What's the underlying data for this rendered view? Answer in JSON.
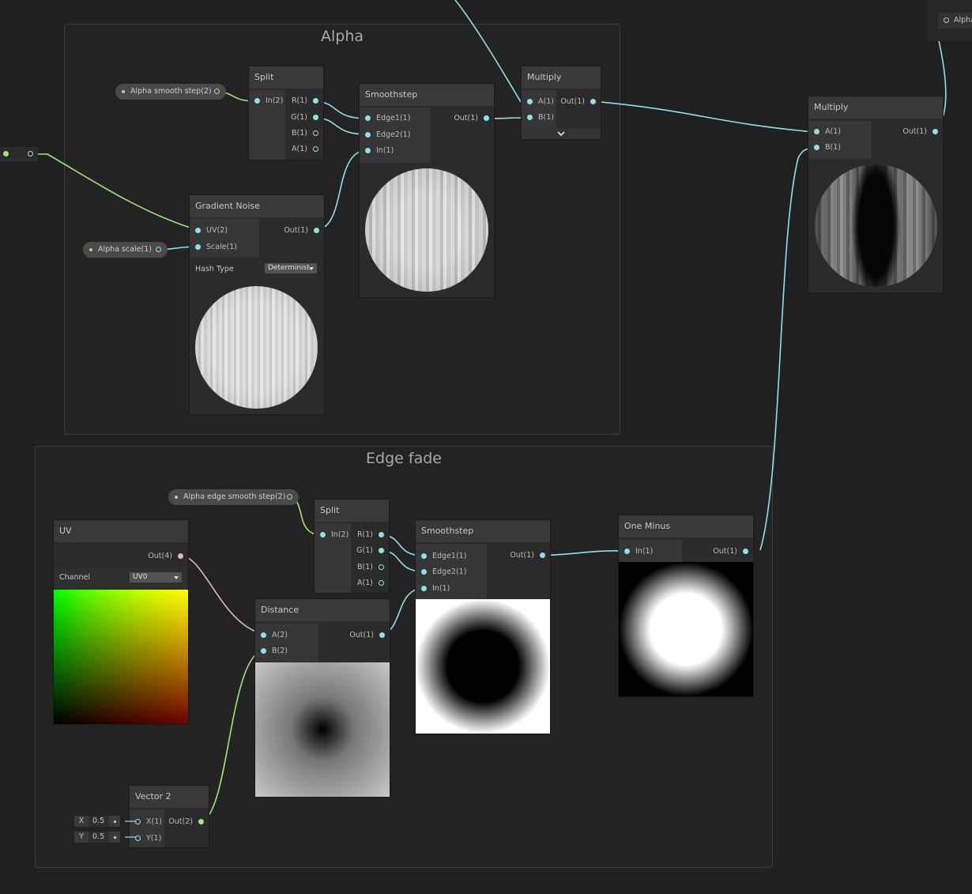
{
  "groups": {
    "alpha": {
      "title": "Alpha"
    },
    "edge_fade": {
      "title": "Edge fade"
    }
  },
  "properties": {
    "alpha_smooth_step": "Alpha smooth step(2)",
    "alpha_scale": "Alpha scale(1)",
    "alpha_edge_smooth_step": "Alpha edge smooth step(2)"
  },
  "nodes": {
    "split_alpha": {
      "title": "Split",
      "in": "In(2)",
      "outs": [
        "R(1)",
        "G(1)",
        "B(1)",
        "A(1)"
      ]
    },
    "smoothstep_alpha": {
      "title": "Smoothstep",
      "ins": [
        "Edge1(1)",
        "Edge2(1)",
        "In(1)"
      ],
      "out": "Out(1)"
    },
    "multiply_small": {
      "title": "Multiply",
      "ins": [
        "A(1)",
        "B(1)"
      ],
      "out": "Out(1)",
      "expand_icon": "chevron-down-icon"
    },
    "multiply_main": {
      "title": "Multiply",
      "ins": [
        "A(1)",
        "B(1)"
      ],
      "out": "Out(1)"
    },
    "gradient_noise": {
      "title": "Gradient Noise",
      "ins": [
        "UV(2)",
        "Scale(1)"
      ],
      "out": "Out(1)",
      "hash_label": "Hash Type",
      "hash_value": "Determinist"
    },
    "uv": {
      "title": "UV",
      "out": "Out(4)",
      "channel_label": "Channel",
      "channel_value": "UV0"
    },
    "split_edge": {
      "title": "Split",
      "in": "In(2)",
      "outs": [
        "R(1)",
        "G(1)",
        "B(1)",
        "A(1)"
      ]
    },
    "smoothstep_edge": {
      "title": "Smoothstep",
      "ins": [
        "Edge1(1)",
        "Edge2(1)",
        "In(1)"
      ],
      "out": "Out(1)"
    },
    "one_minus": {
      "title": "One Minus",
      "in": "In(1)",
      "out": "Out(1)"
    },
    "distance": {
      "title": "Distance",
      "ins": [
        "A(2)",
        "B(2)"
      ],
      "out": "Out(1)"
    },
    "vector2": {
      "title": "Vector 2",
      "ins": [
        "X(1)",
        "Y(1)"
      ],
      "out": "Out(2)",
      "x_label": "X",
      "x_value": "0.5",
      "y_label": "Y",
      "y_value": "0.5"
    }
  },
  "master_stub": {
    "label": "Alpha"
  },
  "colors": {
    "float_wire": "#8fe0ea",
    "vector2_wire": "#9ce67a",
    "vector4_wire": "#e6b0d6",
    "background": "#202020"
  }
}
